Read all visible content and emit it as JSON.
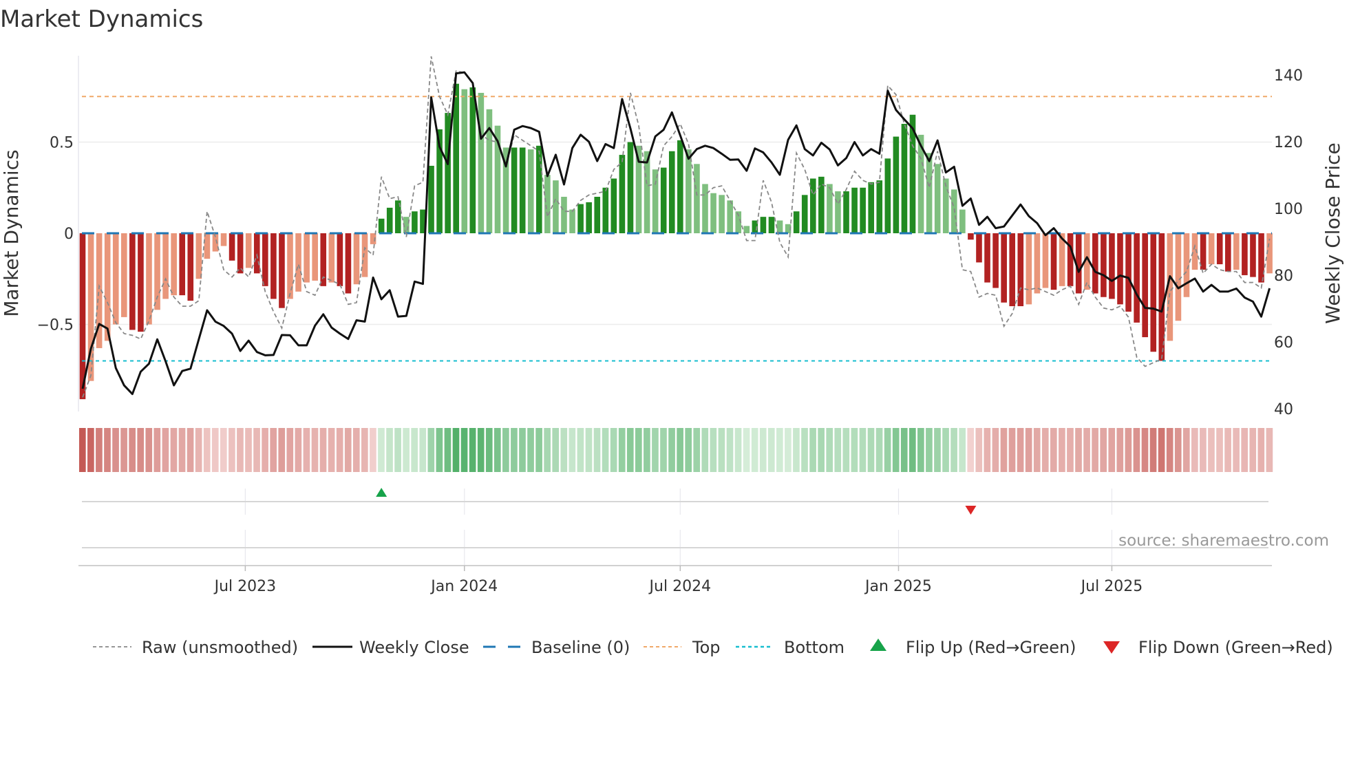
{
  "chart_data": {
    "type": "bar",
    "title": "Market Dynamics",
    "ylabel": "Market Dynamics",
    "y2label": "Weekly Close Price",
    "ylim": [
      -0.97,
      0.97
    ],
    "y2lim": [
      40,
      145
    ],
    "yticks": [
      {
        "v": 0.5,
        "label": "0.5"
      },
      {
        "v": 0,
        "label": "0"
      },
      {
        "v": -0.5,
        "label": "−0.5"
      }
    ],
    "y2ticks": [
      {
        "v": 140,
        "label": "140"
      },
      {
        "v": 120,
        "label": "120"
      },
      {
        "v": 100,
        "label": "100"
      },
      {
        "v": 80,
        "label": "80"
      },
      {
        "v": 60,
        "label": "60"
      },
      {
        "v": 40,
        "label": "40"
      }
    ],
    "xticks": [
      {
        "week": 19.6,
        "label": "Jul 2023"
      },
      {
        "week": 46,
        "label": "Jan 2024"
      },
      {
        "week": 72,
        "label": "Jul 2024"
      },
      {
        "week": 98.3,
        "label": "Jan 2025"
      },
      {
        "week": 124,
        "label": "Jul 2025"
      }
    ],
    "x_unit": "week index (weekly bars)",
    "top_level": 0.75,
    "bottom_level": -0.7,
    "baseline": 0,
    "market_dynamics": [
      -0.91,
      -0.81,
      -0.63,
      -0.59,
      -0.5,
      -0.46,
      -0.53,
      -0.54,
      -0.5,
      -0.42,
      -0.36,
      -0.34,
      -0.34,
      -0.37,
      -0.25,
      -0.14,
      -0.1,
      -0.07,
      -0.15,
      -0.22,
      -0.19,
      -0.22,
      -0.29,
      -0.36,
      -0.41,
      -0.36,
      -0.32,
      -0.27,
      -0.26,
      -0.29,
      -0.27,
      -0.29,
      -0.33,
      -0.28,
      -0.24,
      -0.06,
      0.08,
      0.14,
      0.18,
      0.09,
      0.12,
      0.13,
      0.37,
      0.57,
      0.66,
      0.82,
      0.79,
      0.8,
      0.77,
      0.68,
      0.59,
      0.47,
      0.47,
      0.47,
      0.46,
      0.48,
      0.32,
      0.29,
      0.2,
      0.13,
      0.16,
      0.17,
      0.2,
      0.25,
      0.3,
      0.43,
      0.5,
      0.48,
      0.45,
      0.35,
      0.36,
      0.45,
      0.51,
      0.46,
      0.38,
      0.27,
      0.22,
      0.21,
      0.18,
      0.12,
      0.04,
      0.07,
      0.09,
      0.09,
      0.07,
      0.05,
      0.12,
      0.21,
      0.3,
      0.31,
      0.27,
      0.23,
      0.23,
      0.25,
      0.25,
      0.28,
      0.29,
      0.41,
      0.53,
      0.6,
      0.65,
      0.54,
      0.44,
      0.38,
      0.3,
      0.24,
      0.13,
      -0.035,
      -0.16,
      -0.27,
      -0.3,
      -0.38,
      -0.4,
      -0.4,
      -0.39,
      -0.33,
      -0.3,
      -0.31,
      -0.29,
      -0.29,
      -0.33,
      -0.31,
      -0.33,
      -0.35,
      -0.36,
      -0.39,
      -0.43,
      -0.49,
      -0.57,
      -0.65,
      -0.7,
      -0.59,
      -0.48,
      -0.35,
      -0.2,
      -0.2,
      -0.17,
      -0.17,
      -0.21,
      -0.2,
      -0.23,
      -0.24,
      -0.27,
      -0.22
    ],
    "raw_unsmoothed": [
      -0.9,
      -0.78,
      -0.29,
      -0.38,
      -0.49,
      -0.55,
      -0.56,
      -0.58,
      -0.48,
      -0.35,
      -0.25,
      -0.35,
      -0.4,
      -0.4,
      -0.37,
      0.12,
      -0.02,
      -0.2,
      -0.24,
      -0.19,
      -0.24,
      -0.12,
      -0.32,
      -0.43,
      -0.52,
      -0.33,
      -0.17,
      -0.32,
      -0.34,
      -0.24,
      -0.26,
      -0.28,
      -0.39,
      -0.38,
      -0.08,
      -0.12,
      0.31,
      0.19,
      0.2,
      -0.02,
      0.26,
      0.28,
      0.97,
      0.75,
      0.65,
      0.89,
      0.88,
      0.82,
      0.54,
      0.51,
      0.5,
      0.36,
      0.54,
      0.51,
      0.48,
      0.45,
      0.09,
      0.19,
      0.12,
      0.12,
      0.18,
      0.21,
      0.22,
      0.23,
      0.35,
      0.39,
      0.77,
      0.59,
      0.26,
      0.27,
      0.48,
      0.53,
      0.6,
      0.49,
      0.21,
      0.21,
      0.25,
      0.26,
      0.18,
      0.1,
      -0.04,
      -0.04,
      0.29,
      0.17,
      -0.05,
      -0.13,
      0.44,
      0.35,
      0.21,
      0.27,
      0.25,
      0.16,
      0.24,
      0.34,
      0.29,
      0.27,
      0.28,
      0.81,
      0.76,
      0.6,
      0.48,
      0.41,
      0.25,
      0.45,
      0.26,
      0.14,
      -0.2,
      -0.21,
      -0.35,
      -0.33,
      -0.34,
      -0.51,
      -0.44,
      -0.3,
      -0.31,
      -0.3,
      -0.32,
      -0.34,
      -0.31,
      -0.29,
      -0.39,
      -0.27,
      -0.35,
      -0.41,
      -0.42,
      -0.4,
      -0.46,
      -0.68,
      -0.73,
      -0.71,
      -0.69,
      -0.32,
      -0.26,
      -0.21,
      -0.07,
      -0.22,
      -0.17,
      -0.2,
      -0.21,
      -0.21,
      -0.27,
      -0.27,
      -0.3,
      -0.03
    ],
    "weekly_close": [
      46.0,
      58.0,
      65.4,
      64.0,
      52.2,
      47.0,
      44.4,
      51.1,
      53.5,
      60.8,
      54.2,
      47.0,
      51.3,
      52.0,
      60.8,
      69.5,
      66.1,
      64.8,
      62.5,
      57.3,
      60.4,
      57.0,
      56.0,
      56.1,
      62.1,
      62.0,
      59.0,
      59.0,
      64.9,
      68.3,
      64.3,
      62.5,
      60.9,
      66.5,
      66.1,
      79.3,
      72.8,
      75.5,
      67.6,
      67.8,
      78.1,
      77.4,
      133.3,
      118.5,
      113.3,
      140.5,
      140.8,
      137.6,
      120.9,
      124.1,
      120.2,
      112.6,
      123.6,
      124.7,
      124.1,
      123.0,
      109.7,
      116.1,
      107.2,
      118.1,
      122.1,
      120.0,
      114.2,
      119.3,
      118.1,
      132.8,
      124.0,
      114.0,
      113.8,
      121.6,
      123.6,
      128.8,
      121.9,
      114.9,
      117.8,
      118.8,
      118.1,
      116.4,
      114.6,
      114.7,
      111.3,
      118.0,
      116.8,
      113.8,
      110.1,
      120.6,
      124.9,
      117.8,
      115.9,
      119.7,
      117.7,
      112.9,
      115.1,
      119.9,
      115.9,
      117.8,
      116.4,
      135.3,
      129.5,
      126.7,
      124.0,
      118.8,
      114.2,
      120.4,
      110.8,
      112.5,
      100.8,
      103.0,
      95.1,
      97.5,
      94.1,
      94.6,
      97.9,
      101.2,
      97.7,
      95.6,
      92.0,
      94.1,
      91.0,
      88.6,
      81.0,
      85.4,
      81.0,
      80.0,
      78.3,
      79.9,
      79.2,
      74.2,
      70.2,
      70.0,
      69.1,
      79.7,
      76.1,
      77.6,
      79.0,
      75.1,
      77.1,
      75.1,
      75.1,
      76.0,
      73.3,
      72.1,
      67.6,
      76.1
    ],
    "flips": [
      {
        "type": "up",
        "week": 36
      },
      {
        "type": "down",
        "week": 107
      }
    ],
    "legend": {
      "placement": "bottom",
      "items": [
        {
          "key": "raw",
          "label": "Raw (unsmoothed)"
        },
        {
          "key": "close",
          "label": "Weekly Close"
        },
        {
          "key": "baseline",
          "label": "Baseline (0)"
        },
        {
          "key": "top",
          "label": "Top"
        },
        {
          "key": "bottom",
          "label": "Bottom"
        },
        {
          "key": "flipup",
          "label": "Flip Up (Red→Green)"
        },
        {
          "key": "flipdown",
          "label": "Flip Down (Green→Red)"
        }
      ]
    },
    "source": "source: sharemaestro.com",
    "grid": true
  },
  "colors": {
    "green_strong": "#228b22",
    "green_weak": "#7fbf7f",
    "red_strong": "#b22222",
    "red_weak": "#e9967a",
    "baseline": "#1f77b4",
    "top": "#f0a868",
    "bottom": "#17becf",
    "close": "#111111",
    "raw": "#888888",
    "flip_up": "#17a34a",
    "flip_down": "#dc2626"
  }
}
